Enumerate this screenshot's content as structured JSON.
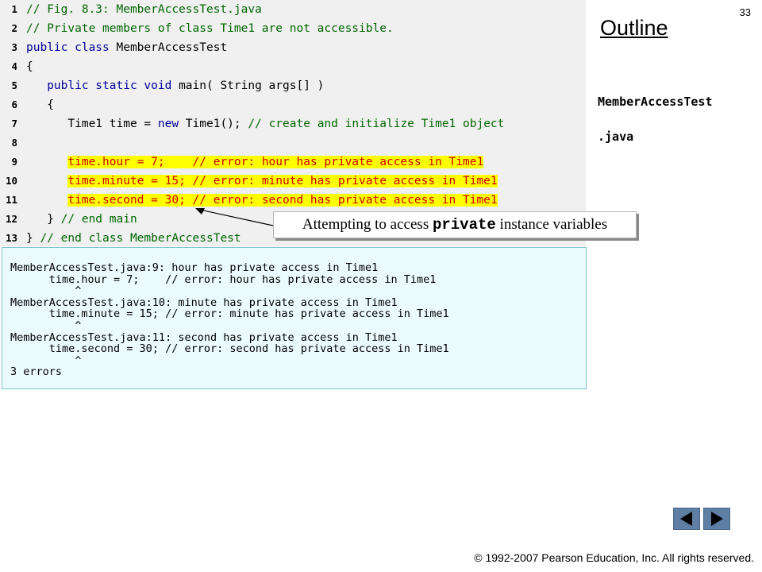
{
  "slide": {
    "page_number": "33",
    "outline_title": "Outline",
    "filename_line1": "MemberAccessTest",
    "filename_line2": ".java",
    "copyright": "© 1992-2007 Pearson Education, Inc.  All rights reserved."
  },
  "code": {
    "lines": [
      {
        "num": "1",
        "segments": [
          {
            "t": "// Fig. 8.3: MemberAccessTest.java",
            "c": "cm"
          }
        ]
      },
      {
        "num": "2",
        "segments": [
          {
            "t": "// Private members of class Time1 are not accessible.",
            "c": "cm"
          }
        ]
      },
      {
        "num": "3",
        "segments": [
          {
            "t": "public class",
            "c": "kw"
          },
          {
            "t": " MemberAccessTest",
            "c": ""
          }
        ]
      },
      {
        "num": "4",
        "segments": [
          {
            "t": "{",
            "c": ""
          }
        ]
      },
      {
        "num": "5",
        "segments": [
          {
            "t": "   ",
            "c": ""
          },
          {
            "t": "public static void",
            "c": "kw"
          },
          {
            "t": " main( String args[] )",
            "c": ""
          }
        ]
      },
      {
        "num": "6",
        "segments": [
          {
            "t": "   {",
            "c": ""
          }
        ]
      },
      {
        "num": "7",
        "segments": [
          {
            "t": "      Time1 time = ",
            "c": ""
          },
          {
            "t": "new",
            "c": "kw"
          },
          {
            "t": " Time1(); ",
            "c": ""
          },
          {
            "t": "// create and initialize Time1 object",
            "c": "cm"
          }
        ]
      },
      {
        "num": "8",
        "segments": [
          {
            "t": "",
            "c": ""
          }
        ]
      },
      {
        "num": "9",
        "segments": [
          {
            "t": "      ",
            "c": ""
          },
          {
            "t": "time.hour = 7;    // error: hour has private access in Time1",
            "c": "err hl"
          }
        ]
      },
      {
        "num": "10",
        "segments": [
          {
            "t": "      ",
            "c": ""
          },
          {
            "t": "time.minute = 15; // error: minute has private access in Time1",
            "c": "err hl"
          }
        ]
      },
      {
        "num": "11",
        "segments": [
          {
            "t": "      ",
            "c": ""
          },
          {
            "t": "time.second = 30; // error: second has private access in Time1",
            "c": "err hl"
          }
        ]
      },
      {
        "num": "12",
        "segments": [
          {
            "t": "   } ",
            "c": ""
          },
          {
            "t": "// end main",
            "c": "cm"
          }
        ]
      },
      {
        "num": "13",
        "segments": [
          {
            "t": "} ",
            "c": ""
          },
          {
            "t": "// end class MemberAccessTest",
            "c": "cm"
          }
        ]
      }
    ]
  },
  "output": {
    "lines": [
      "MemberAccessTest.java:9: hour has private access in Time1",
      "      time.hour = 7;    // error: hour has private access in Time1",
      "          ^",
      "MemberAccessTest.java:10: minute has private access in Time1",
      "      time.minute = 15; // error: minute has private access in Time1",
      "          ^",
      "MemberAccessTest.java:11: second has private access in Time1",
      "      time.second = 30; // error: second has private access in Time1",
      "          ^",
      "3 errors"
    ]
  },
  "callout": {
    "prefix": "Attempting to access ",
    "keyword": "private",
    "suffix": " instance variables"
  },
  "nav": {
    "prev_icon": "left-triangle-icon",
    "next_icon": "right-triangle-icon"
  },
  "colors": {
    "highlight": "#ffff00",
    "keyword": "#000099",
    "comment": "#006600",
    "error": "#cc0000",
    "nav_button": "#5e7ea4"
  }
}
